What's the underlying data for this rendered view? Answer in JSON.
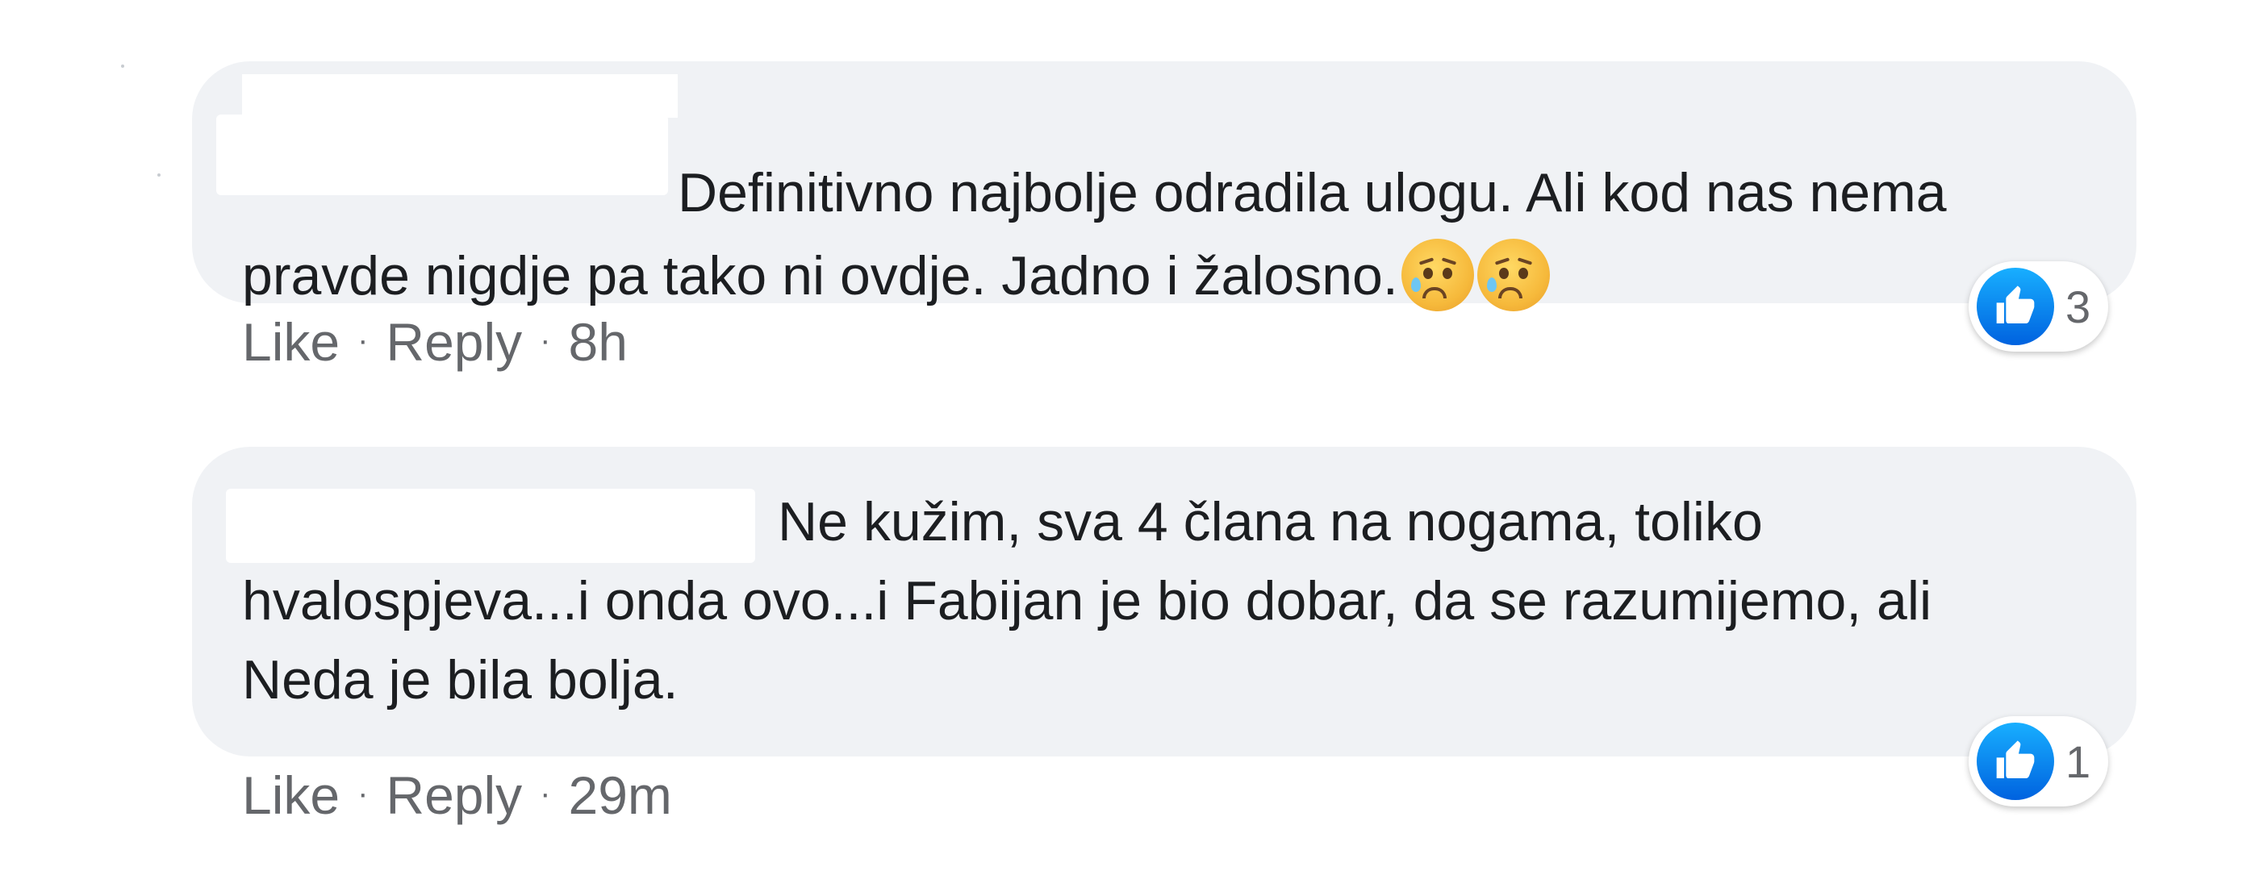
{
  "colors": {
    "bubble_background": "#f0f2f5",
    "text": "#1c1e21",
    "meta_text": "#65676b",
    "like_blue": "#1877f2"
  },
  "comments": [
    {
      "text": "Definitivno najbolje odradila ulogu. Ali kod nas nema pravde nigdje pa tako ni ovdje. Jadno i žalosno.",
      "author_redacted": true,
      "emojis": [
        "sad-relieved-face",
        "sad-relieved-face"
      ],
      "like_label": "Like",
      "reply_label": "Reply",
      "separator": "·",
      "timestamp": "8h",
      "reaction_icon": "thumbs-up-icon",
      "reaction_count": "3"
    },
    {
      "text": "Ne kužim, sva 4 člana na nogama, toliko hvalospjeva...i onda ovo...i Fabijan je bio dobar, da se razumijemo, ali Neda je bila bolja.",
      "author_redacted": true,
      "emojis": [],
      "like_label": "Like",
      "reply_label": "Reply",
      "separator": "·",
      "timestamp": "29m",
      "reaction_icon": "thumbs-up-icon",
      "reaction_count": "1"
    }
  ]
}
